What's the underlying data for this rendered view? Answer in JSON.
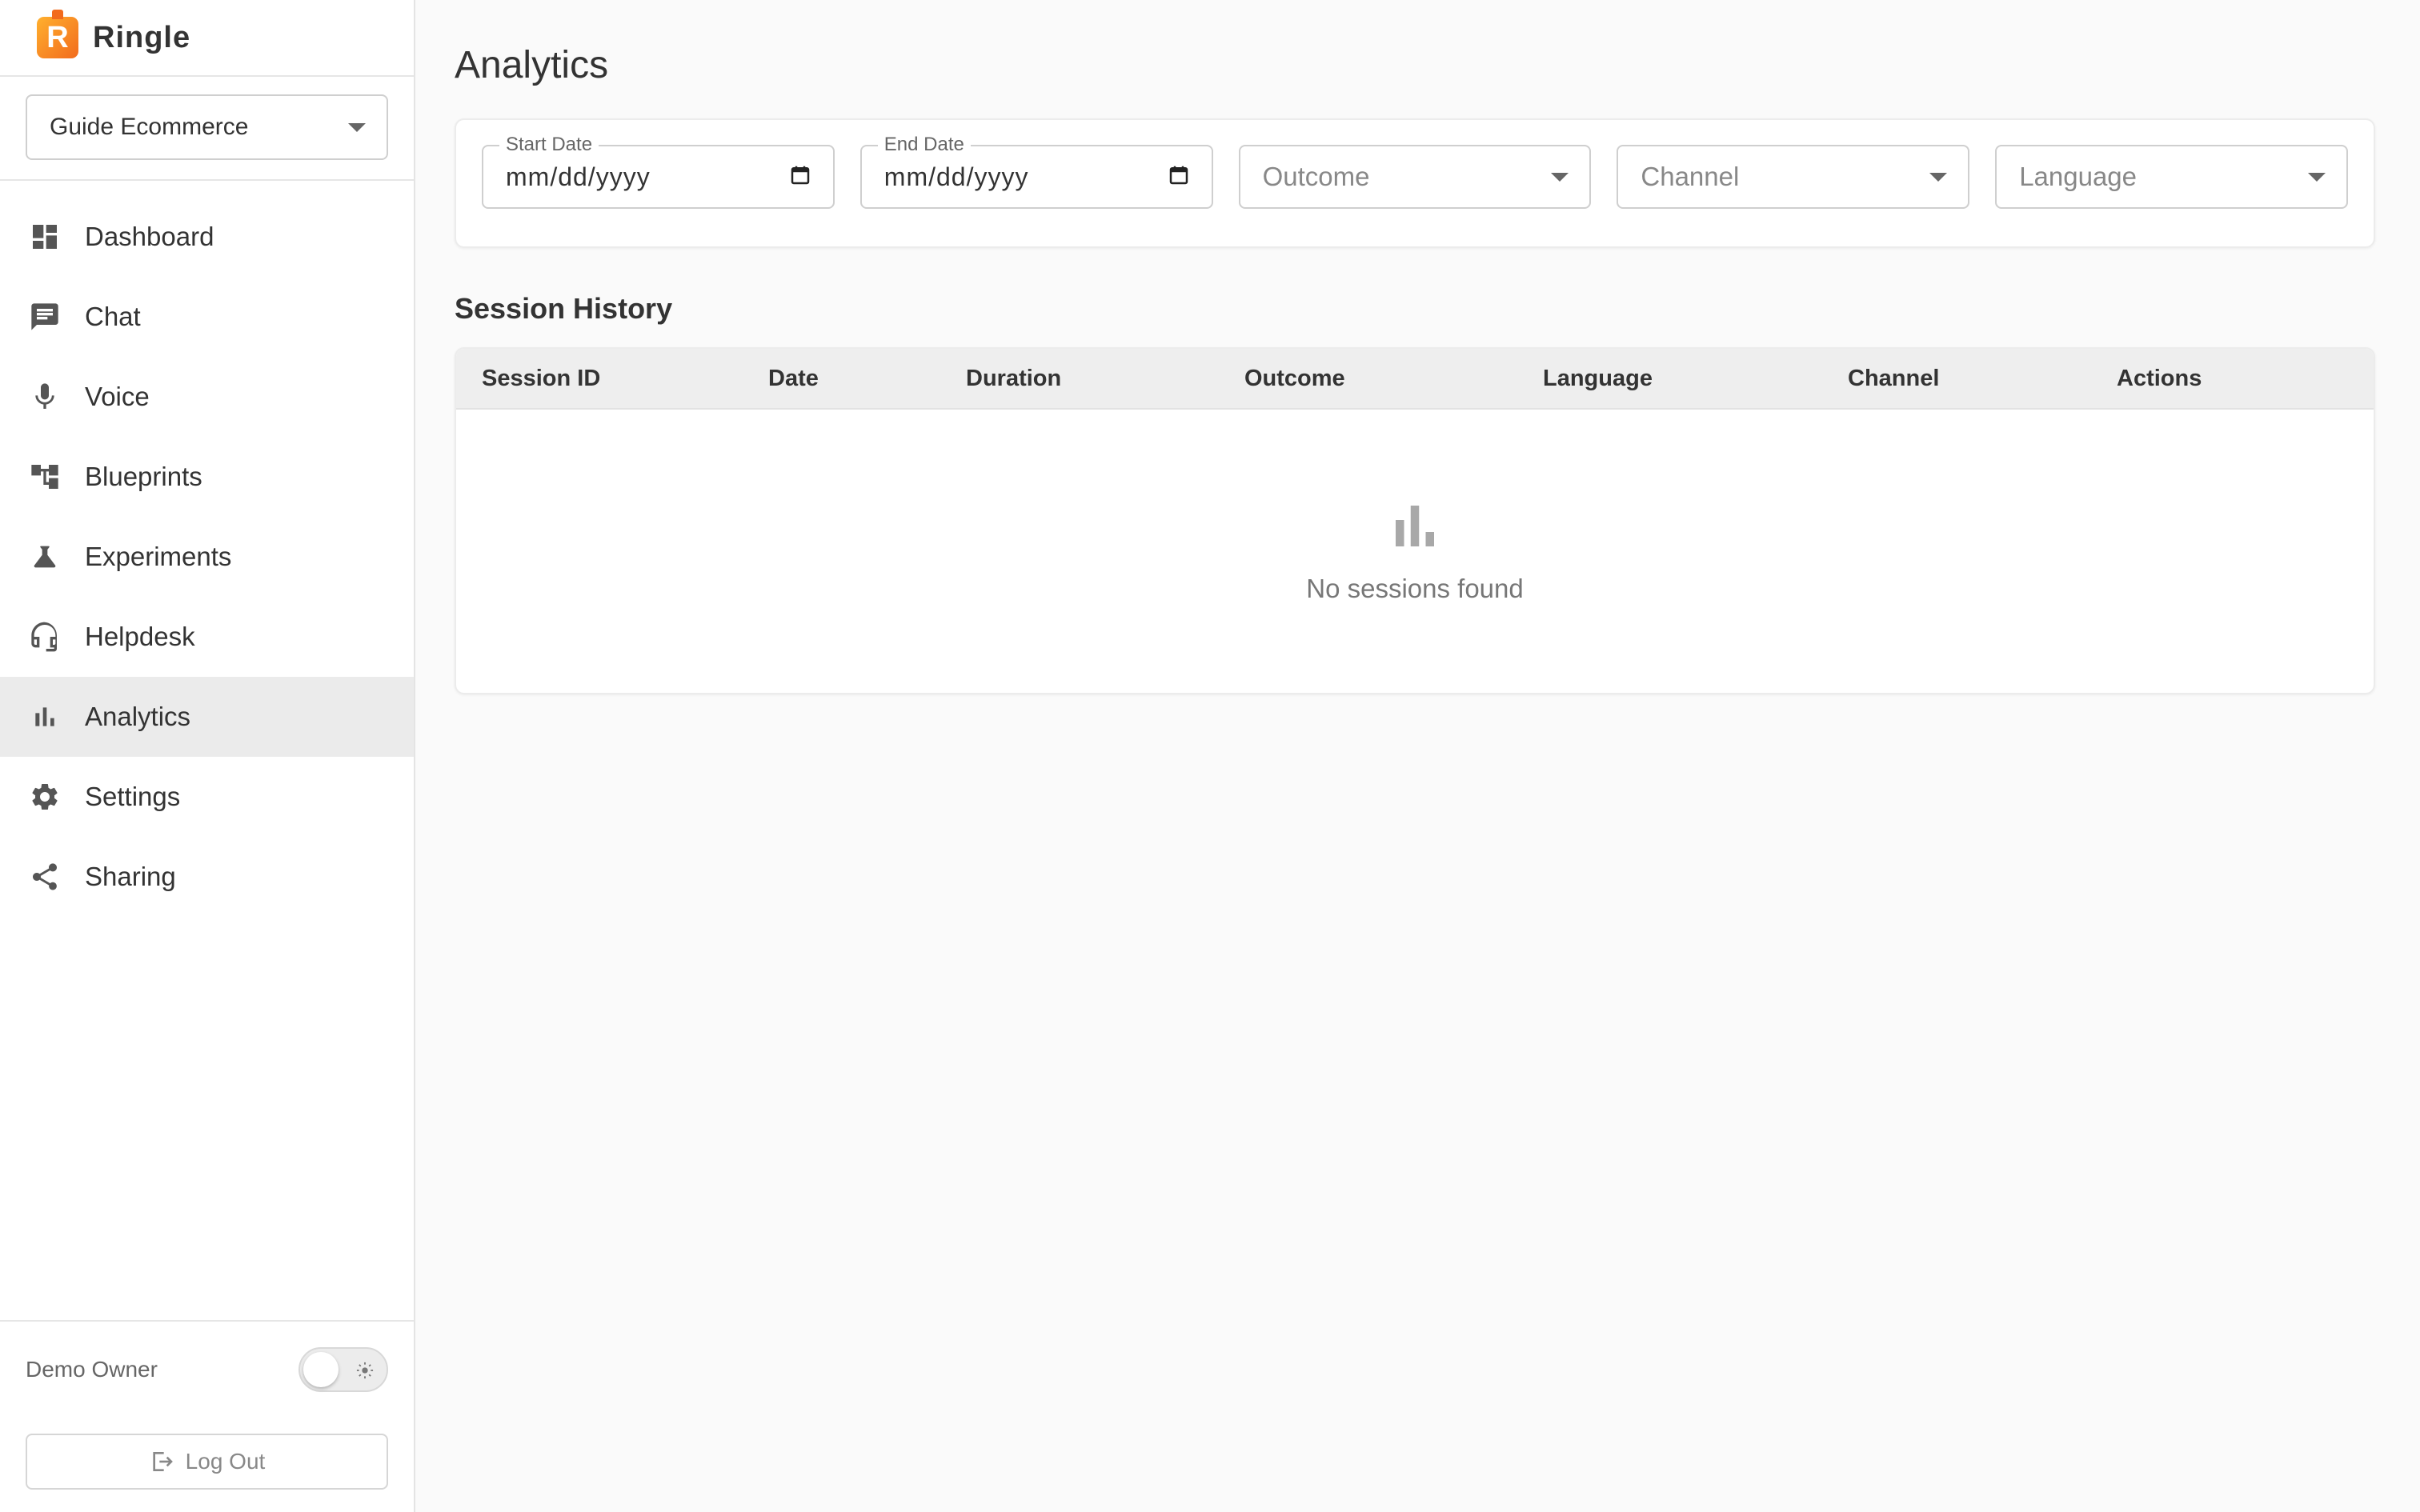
{
  "brand": {
    "name": "Ringle",
    "logo_letter": "R"
  },
  "project_select": {
    "value": "Guide Ecommerce"
  },
  "nav": [
    {
      "label": "Dashboard",
      "icon": "dashboard-icon"
    },
    {
      "label": "Chat",
      "icon": "chat-icon"
    },
    {
      "label": "Voice",
      "icon": "microphone-icon"
    },
    {
      "label": "Blueprints",
      "icon": "blueprints-icon"
    },
    {
      "label": "Experiments",
      "icon": "flask-icon"
    },
    {
      "label": "Helpdesk",
      "icon": "headset-icon"
    },
    {
      "label": "Analytics",
      "icon": "bar-chart-icon",
      "active": true
    },
    {
      "label": "Settings",
      "icon": "gear-icon"
    },
    {
      "label": "Sharing",
      "icon": "share-icon"
    }
  ],
  "footer": {
    "owner": "Demo Owner",
    "logout": "Log Out"
  },
  "page": {
    "title": "Analytics"
  },
  "filters": {
    "start_date": {
      "label": "Start Date",
      "value": "mm/dd/yyyy"
    },
    "end_date": {
      "label": "End Date",
      "value": "mm/dd/yyyy"
    },
    "outcome": {
      "placeholder": "Outcome"
    },
    "channel": {
      "placeholder": "Channel"
    },
    "language": {
      "placeholder": "Language"
    }
  },
  "session_history": {
    "title": "Session History",
    "columns": [
      "Session ID",
      "Date",
      "Duration",
      "Outcome",
      "Language",
      "Channel",
      "Actions"
    ],
    "empty_text": "No sessions found"
  },
  "colors": {
    "accent": "#f26b1d",
    "active_nav_bg": "#ebebeb"
  }
}
